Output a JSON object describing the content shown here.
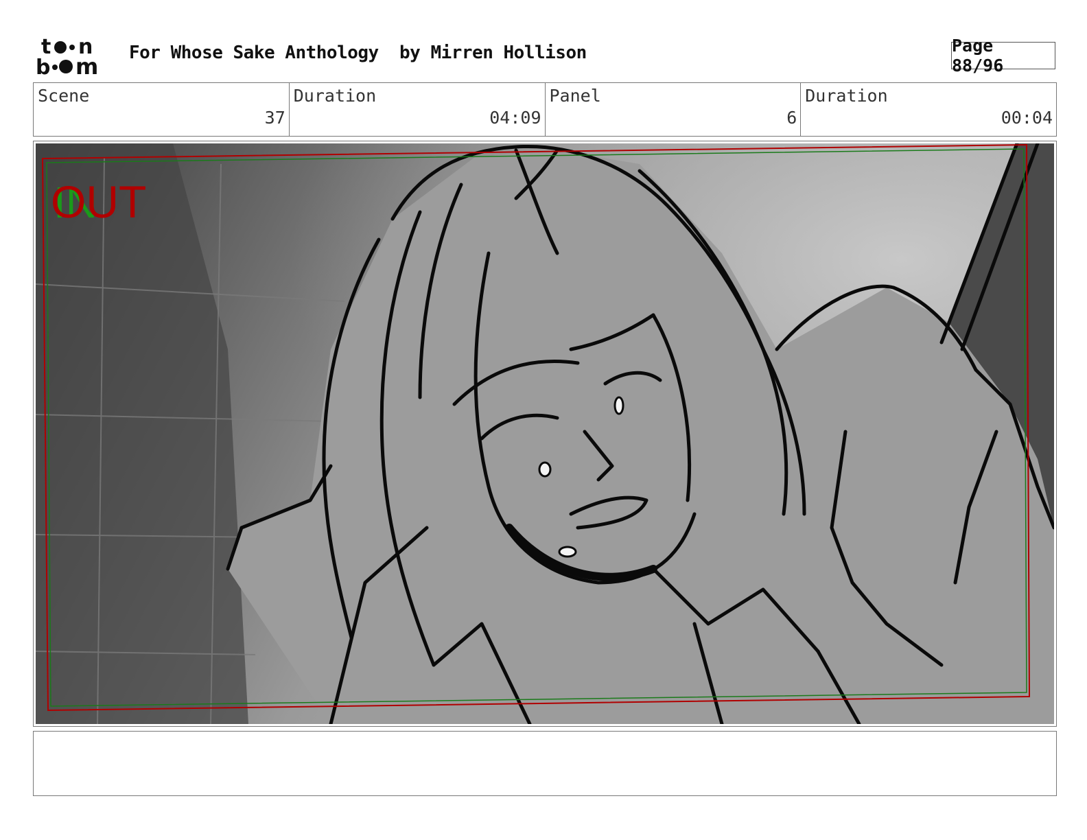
{
  "header": {
    "title": "For Whose Sake Anthology  by Mirren Hollison",
    "page_label": "Page 88/96"
  },
  "logo": {
    "text": "toon boom",
    "icon": "toon-boom-logo"
  },
  "info": {
    "scene_label": "Scene",
    "scene_value": "37",
    "scene_duration_label": "Duration",
    "scene_duration_value": "04:09",
    "panel_label": "Panel",
    "panel_value": "6",
    "panel_duration_label": "Duration",
    "panel_duration_value": "00:04"
  },
  "panel": {
    "out_marker": "OUT",
    "in_marker": "IN",
    "out_color": "#b00000",
    "in_color": "#1a9a1a"
  },
  "notes": {
    "text": ""
  }
}
